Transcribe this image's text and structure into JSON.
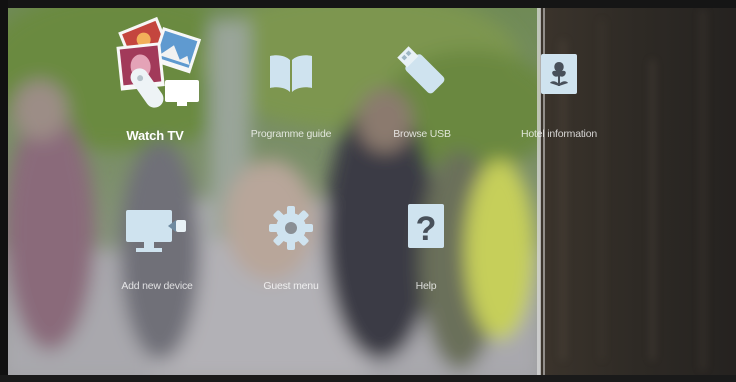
{
  "menu": {
    "items": [
      {
        "label": "Watch TV",
        "icon": "watch-tv-icon",
        "selected": true
      },
      {
        "label": "Programme guide",
        "icon": "book-icon",
        "selected": false
      },
      {
        "label": "Browse USB",
        "icon": "usb-icon",
        "selected": false
      },
      {
        "label": "Hotel information",
        "icon": "flower-icon",
        "selected": false
      },
      {
        "label": "Add new device",
        "icon": "monitor-plug-icon",
        "selected": false
      },
      {
        "label": "Guest menu",
        "icon": "gear-icon",
        "selected": false
      },
      {
        "label": "Help",
        "icon": "question-icon",
        "selected": false
      }
    ]
  },
  "colors": {
    "icon": "#cfe3ef",
    "label": "#ffffff"
  }
}
